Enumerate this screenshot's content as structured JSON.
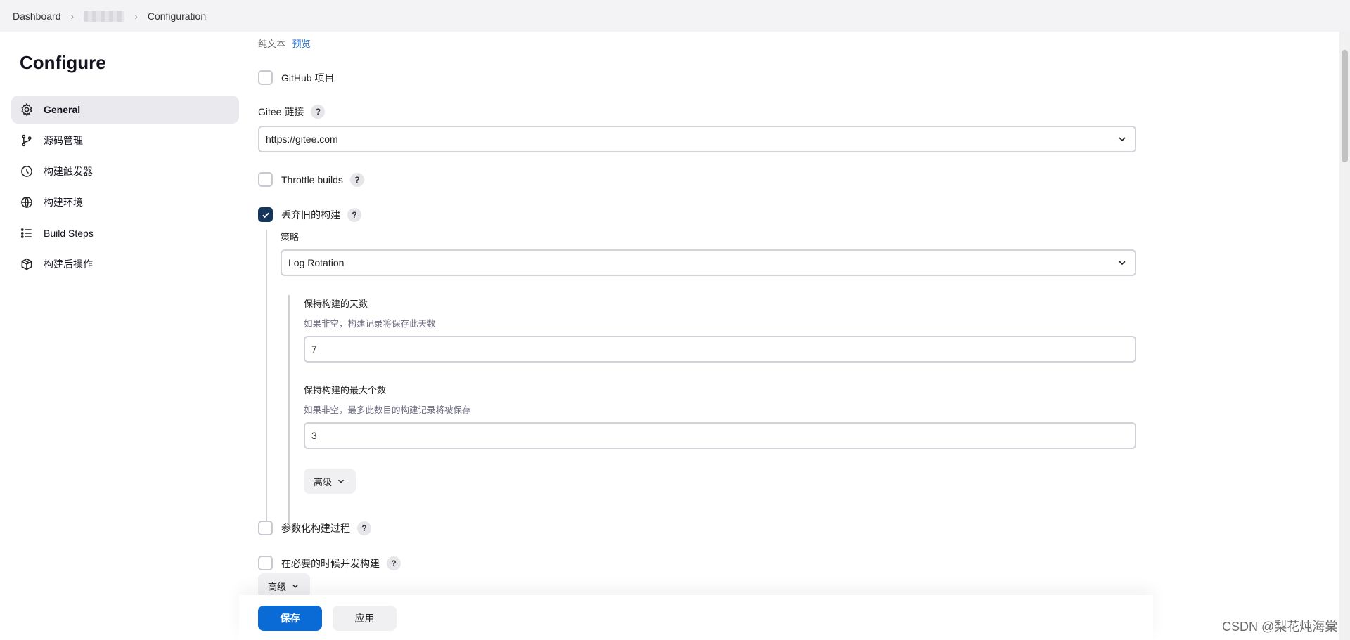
{
  "breadcrumb": {
    "dashboard": "Dashboard",
    "current": "Configuration"
  },
  "sidebar": {
    "title": "Configure",
    "items": [
      {
        "label": "General",
        "icon": "gear-icon"
      },
      {
        "label": "源码管理",
        "icon": "branch-icon"
      },
      {
        "label": "构建触发器",
        "icon": "clock-icon"
      },
      {
        "label": "构建环境",
        "icon": "globe-icon"
      },
      {
        "label": "Build Steps",
        "icon": "list-icon"
      },
      {
        "label": "构建后操作",
        "icon": "package-icon"
      }
    ]
  },
  "form": {
    "plain_text": "纯文本",
    "preview": "预览",
    "github_project": "GitHub 项目",
    "gitee_label": "Gitee 链接",
    "gitee_value": "https://gitee.com",
    "throttle_builds": "Throttle builds",
    "discard_old": "丢弃旧的构建",
    "strategy_label": "策略",
    "strategy_value": "Log Rotation",
    "days_label": "保持构建的天数",
    "days_desc": "如果非空，构建记录将保存此天数",
    "days_value": "7",
    "max_label": "保持构建的最大个数",
    "max_desc": "如果非空，最多此数目的构建记录将被保存",
    "max_value": "3",
    "advanced": "高级",
    "parameterized": "参数化构建过程",
    "concurrent": "在必要的时候并发构建",
    "advanced_outer": "高级",
    "help": "?"
  },
  "actions": {
    "save": "保存",
    "apply": "应用"
  },
  "state": {
    "github_project_checked": false,
    "throttle_checked": false,
    "discard_checked": true,
    "parameterized_checked": false,
    "concurrent_checked": false
  },
  "colors": {
    "primary": "#0b6bd6",
    "checked": "#15365a",
    "link": "#1f6fd1"
  },
  "watermark": "CSDN @梨花炖海棠"
}
